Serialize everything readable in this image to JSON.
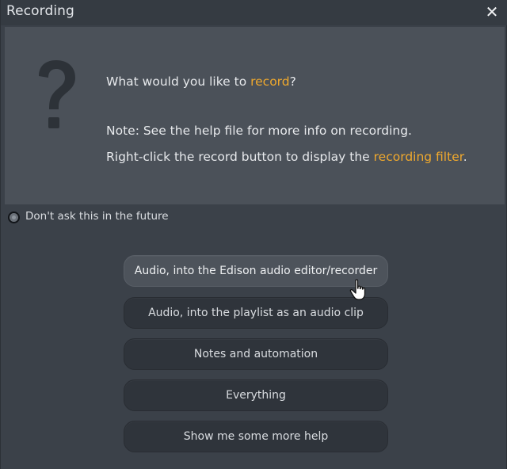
{
  "window": {
    "title": "Recording",
    "close_glyph": "✕"
  },
  "info": {
    "question_prefix": "What would you like to ",
    "question_accent": "record",
    "question_suffix": "?",
    "note_line": "Note: See the help file for more info on recording.",
    "rightclick_prefix": "Right-click the record button to display the ",
    "rightclick_accent": "recording filter",
    "rightclick_suffix": ".",
    "icon": "question-mark-icon"
  },
  "option": {
    "dont_ask_label": "Don't ask this in the future",
    "checked": false
  },
  "buttons": [
    {
      "label": "Audio, into the Edison audio editor/recorder"
    },
    {
      "label": "Audio, into the playlist as an audio clip"
    },
    {
      "label": "Notes and automation"
    },
    {
      "label": "Everything"
    },
    {
      "label": "Show me some more help"
    }
  ],
  "colors": {
    "accent": "#f0a92d",
    "background": "#3b4149",
    "panel": "#4b5159",
    "button": "#2f343b",
    "button_hover": "#4d535b"
  },
  "cursor": "hand-pointer-icon"
}
